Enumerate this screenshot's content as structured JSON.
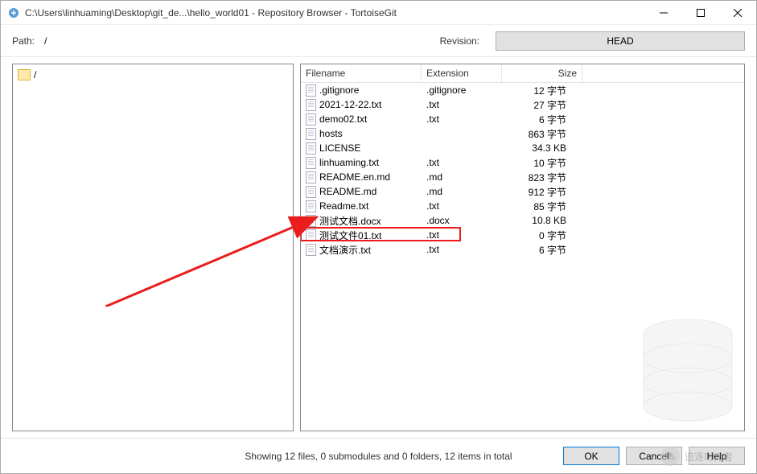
{
  "window": {
    "title": "C:\\Users\\linhuaming\\Desktop\\git_de...\\hello_world01 - Repository Browser - TortoiseGit"
  },
  "toolbar": {
    "path_label": "Path:",
    "path_value": "/",
    "revision_label": "Revision:",
    "head_button": "HEAD"
  },
  "tree": {
    "root": "/"
  },
  "columns": {
    "filename": "Filename",
    "extension": "Extension",
    "size": "Size"
  },
  "files": [
    {
      "name": ".gitignore",
      "ext": ".gitignore",
      "size": "12 字节"
    },
    {
      "name": "2021-12-22.txt",
      "ext": ".txt",
      "size": "27 字节"
    },
    {
      "name": "demo02.txt",
      "ext": ".txt",
      "size": "6 字节"
    },
    {
      "name": "hosts",
      "ext": "",
      "size": "863 字节"
    },
    {
      "name": "LICENSE",
      "ext": "",
      "size": "34.3 KB"
    },
    {
      "name": "linhuaming.txt",
      "ext": ".txt",
      "size": "10 字节"
    },
    {
      "name": "README.en.md",
      "ext": ".md",
      "size": "823 字节"
    },
    {
      "name": "README.md",
      "ext": ".md",
      "size": "912 字节"
    },
    {
      "name": "Readme.txt",
      "ext": ".txt",
      "size": "85 字节"
    },
    {
      "name": "测试文档.docx",
      "ext": ".docx",
      "size": "10.8 KB"
    },
    {
      "name": "测试文件01.txt",
      "ext": ".txt",
      "size": "0 字节"
    },
    {
      "name": "文档演示.txt",
      "ext": ".txt",
      "size": "6 字节"
    }
  ],
  "highlighted_index": 10,
  "status": {
    "text": "Showing 12 files, 0 submodules and 0 folders, 12 items in total"
  },
  "buttons": {
    "ok": "OK",
    "cancel": "Cancel",
    "help": "Help"
  },
  "watermark": {
    "text": "追逐时光者"
  }
}
